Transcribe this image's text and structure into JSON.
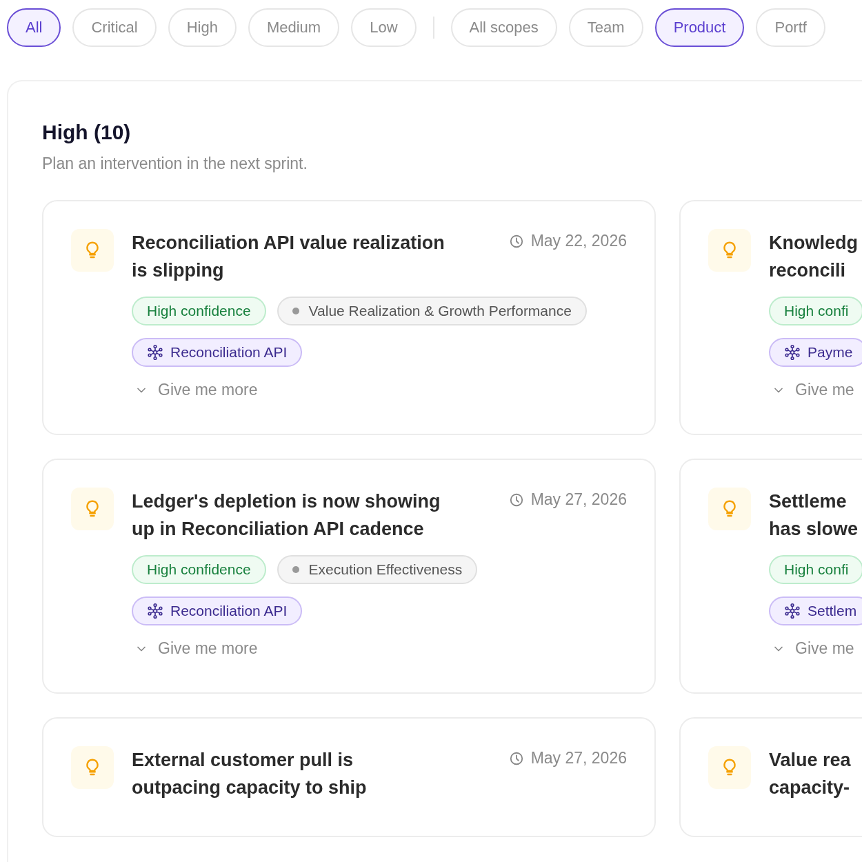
{
  "filters": [
    [
      {
        "label": "All",
        "selected": true
      },
      {
        "label": "Critical",
        "selected": false
      },
      {
        "label": "High",
        "selected": false
      },
      {
        "label": "Medium",
        "selected": false
      },
      {
        "label": "Low",
        "selected": false
      }
    ],
    [
      {
        "label": "All scopes",
        "selected": false
      },
      {
        "label": "Team",
        "selected": false
      },
      {
        "label": "Product",
        "selected": true
      },
      {
        "label": "Portf",
        "selected": false
      }
    ]
  ],
  "section": {
    "title": "High (10)",
    "subtitle": "Plan an intervention in the next sprint."
  },
  "cards": [
    {
      "title_lines": [
        "Reconciliation API value realization",
        "is slipping"
      ],
      "date": "May 22, 2026",
      "tags": [
        {
          "kind": "confidence",
          "label": "High confidence"
        },
        {
          "kind": "category",
          "label": "Value Realization & Growth Performance"
        }
      ],
      "product": "Reconciliation API",
      "more_label": "Give me more"
    },
    {
      "title_lines": [
        "Knowledg",
        "reconcili"
      ],
      "tags": [
        {
          "kind": "confidence",
          "label": "High confi"
        }
      ],
      "product": "Payme",
      "more_label": "Give me"
    },
    {
      "title_lines": [
        "Ledger's depletion is now showing",
        "up in Reconciliation API cadence"
      ],
      "date": "May 27, 2026",
      "tags": [
        {
          "kind": "confidence",
          "label": "High confidence"
        },
        {
          "kind": "category",
          "label": "Execution Effectiveness"
        }
      ],
      "product": "Reconciliation API",
      "more_label": "Give me more"
    },
    {
      "title_lines": [
        "Settleme",
        "has slowe"
      ],
      "tags": [
        {
          "kind": "confidence",
          "label": "High confi"
        }
      ],
      "product": "Settlem",
      "more_label": "Give me"
    },
    {
      "title_lines": [
        "External customer pull is",
        "outpacing capacity to ship"
      ],
      "date": "May 27, 2026"
    },
    {
      "title_lines": [
        "Value rea",
        "capacity-"
      ]
    }
  ]
}
